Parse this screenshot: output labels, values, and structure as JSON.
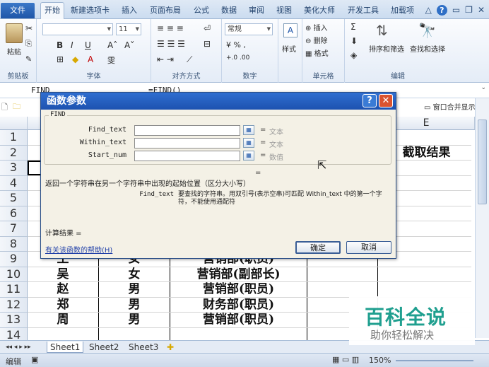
{
  "tabs": [
    "文件",
    "开始",
    "新建选项卡",
    "插入",
    "页面布局",
    "公式",
    "数据",
    "审阅",
    "视图",
    "美化大师",
    "开发工具",
    "加载项"
  ],
  "ribbon": {
    "paste": "粘贴",
    "font_name": "",
    "font_size": "11",
    "number_format": "常规",
    "bold": "B",
    "italic": "I",
    "underline": "U",
    "style": "样式",
    "insert": "插入",
    "delete": "删除",
    "format": "格式",
    "sort_filter": "排序和筛选",
    "find_select": "查找和选择",
    "groups": [
      "剪贴板",
      "字体",
      "对齐方式",
      "数字",
      "单元格",
      "编辑"
    ]
  },
  "formula_bar": {
    "name_box": "FIND",
    "formula": "=FIND()"
  },
  "window_label": "窗口合并显示",
  "columns": [
    "E"
  ],
  "rows": [
    {
      "n": "1",
      "cells": [
        "",
        "",
        "",
        "",
        ""
      ]
    },
    {
      "n": "2",
      "cells": [
        "",
        "",
        "",
        "",
        "截取结果"
      ]
    },
    {
      "n": "3",
      "cells": [
        "",
        "",
        "",
        "",
        ""
      ]
    },
    {
      "n": "4",
      "cells": [
        "",
        "",
        "",
        "",
        ""
      ]
    },
    {
      "n": "5",
      "cells": [
        "",
        "",
        "",
        "",
        ""
      ]
    },
    {
      "n": "6",
      "cells": [
        "",
        "",
        "",
        "",
        ""
      ]
    },
    {
      "n": "7",
      "cells": [
        "",
        "",
        "",
        "",
        ""
      ]
    },
    {
      "n": "8",
      "cells": [
        "",
        "",
        "",
        "",
        ""
      ]
    },
    {
      "n": "9",
      "cells": [
        "王",
        "女",
        "营销部(职员)",
        "",
        ""
      ]
    },
    {
      "n": "10",
      "cells": [
        "吴",
        "女",
        "营销部(副部长)",
        "",
        ""
      ]
    },
    {
      "n": "11",
      "cells": [
        "赵",
        "男",
        "营销部(职员)",
        "",
        ""
      ]
    },
    {
      "n": "12",
      "cells": [
        "郑",
        "男",
        "财务部(职员)",
        "",
        ""
      ]
    },
    {
      "n": "13",
      "cells": [
        "周",
        "男",
        "营销部(职员)",
        "",
        ""
      ]
    },
    {
      "n": "14",
      "cells": [
        "",
        "",
        "",
        "",
        ""
      ]
    }
  ],
  "dialog": {
    "title": "函数参数",
    "help_btn": "?",
    "close_btn": "✕",
    "func_name": "FIND",
    "args": [
      {
        "label": "Find_text",
        "hint": "文本"
      },
      {
        "label": "Within_text",
        "hint": "文本"
      },
      {
        "label": "Start_num",
        "hint": "数值"
      }
    ],
    "eq": "=",
    "result_eq": "=",
    "description": "返回一个字符串在另一个字符串中出现的起始位置（区分大小写）",
    "arg_desc_name": "Find_text",
    "arg_desc": "要查找的字符串。用双引号(表示空串)可匹配 Within_text 中的第一个字符，不能使用通配符",
    "calc_result": "计算结果 =",
    "help_link": "有关该函数的帮助(H)",
    "ok": "确定",
    "cancel": "取消"
  },
  "sheets": [
    "Sheet1",
    "Sheet2",
    "Sheet3"
  ],
  "status": {
    "mode": "编辑",
    "zoom": "150%"
  },
  "watermark": {
    "title": "百科全说",
    "subtitle": "助你轻松解决"
  }
}
